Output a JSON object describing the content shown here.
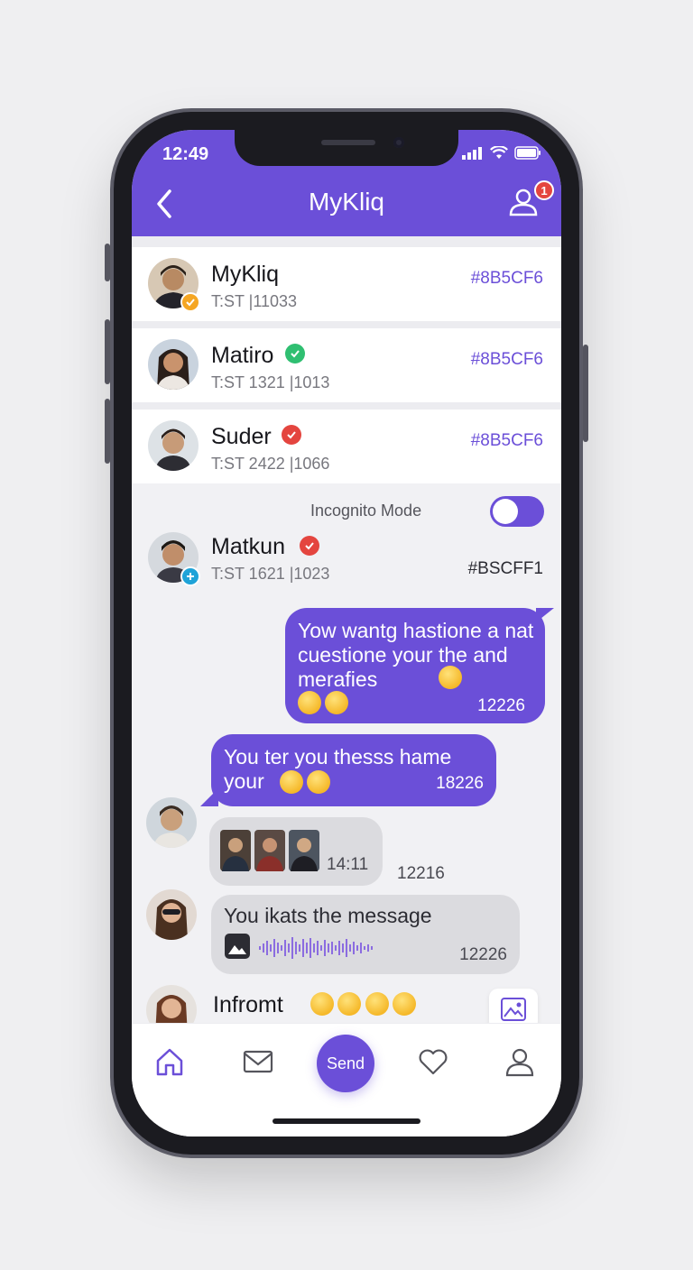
{
  "status_bar": {
    "time": "12:49"
  },
  "header": {
    "title": "MyKliq",
    "notification_count": "1"
  },
  "contacts": [
    {
      "name": "MyKliq",
      "subtitle": "T:ST |11033",
      "code": "#8B5CF6",
      "verified_color": "#f5a623"
    },
    {
      "name": "Matiro",
      "subtitle": "T:ST 1321 |1013",
      "code": "#8B5CF6",
      "verified_color": "#2fbf71"
    },
    {
      "name": "Suder",
      "subtitle": "T:ST 2422 |1066",
      "code": "#8B5CF6",
      "verified_color": "#e4453f"
    }
  ],
  "incognito": {
    "label": "Incognito Mode",
    "enabled": true
  },
  "active_contact": {
    "name": "Matkun",
    "subtitle": "T:ST 1621 |1023",
    "code": "#BSCFF1",
    "verified_color": "#e4453f"
  },
  "messages": [
    {
      "text": "Yow wantg hastione a nat cuestione your the and merafies",
      "time": "12226",
      "emojis": [
        "kiss-emoji",
        "dizzy-emoji",
        "kiss-emoji"
      ]
    },
    {
      "text": "You ter you thesss hame your",
      "time": "18226",
      "emojis": [
        "kiss-emoji",
        "heart-eyes-emoji"
      ]
    },
    {
      "image_time": "14:11",
      "outside_time": "12216"
    },
    {
      "text": "You ikats the message",
      "time": "12226"
    }
  ],
  "composer": {
    "text": "Infromt",
    "emojis": [
      "shocked-emoji",
      "squint-emoji",
      "kiss-emoji",
      "kiss-emoji"
    ]
  },
  "bottom_nav": {
    "send_label": "Send",
    "items": [
      "home-icon",
      "mail-icon",
      "send-button",
      "heart-icon",
      "profile-icon"
    ]
  },
  "colors": {
    "accent": "#6b4fd8",
    "incoming_bubble": "#dbdbdf",
    "badge": "#e4453f"
  }
}
